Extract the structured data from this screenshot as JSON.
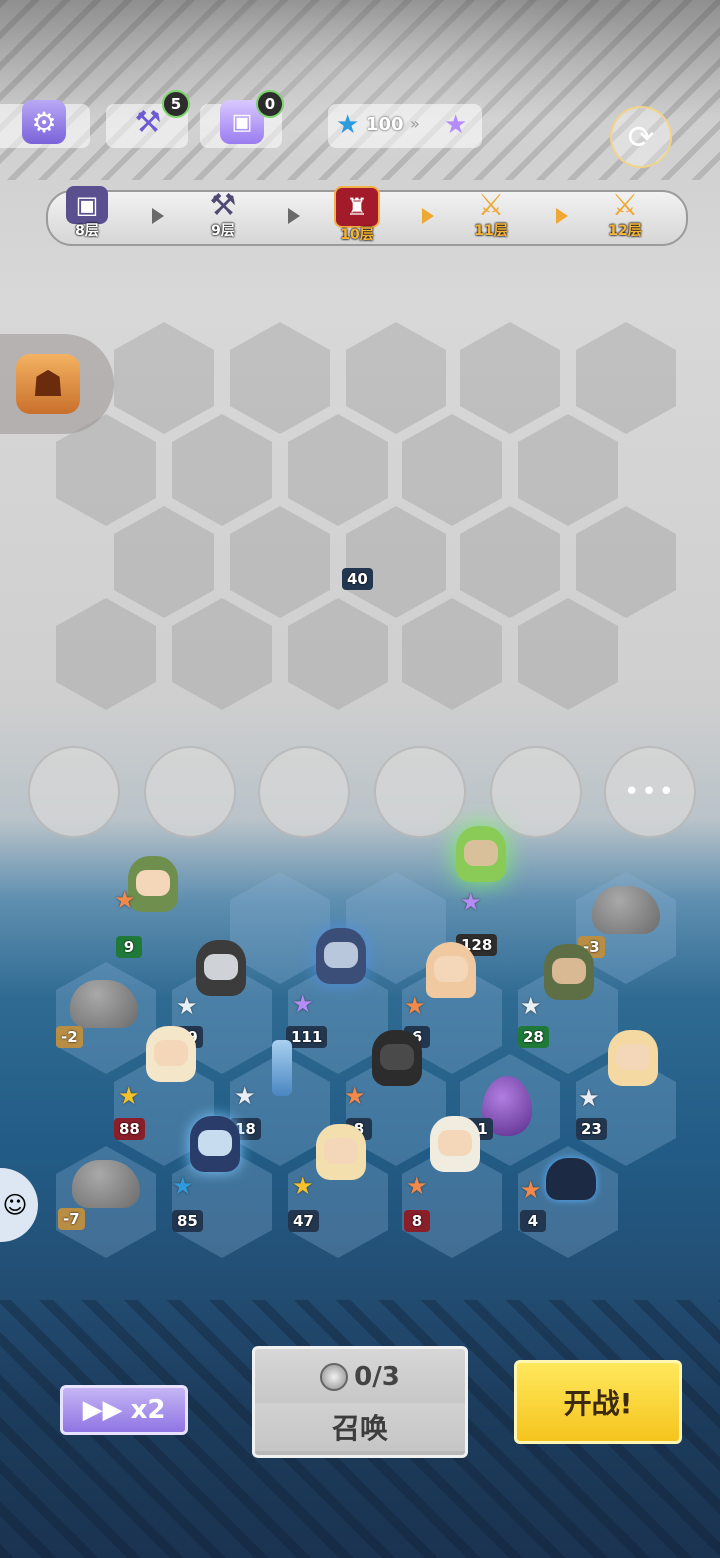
{
  "top_bar": {
    "settings_icon": "gear-icon",
    "anvil_count": "5",
    "chest_count": "0",
    "stars_value": "100",
    "refresh_icon": "refresh-icon"
  },
  "floors": [
    {
      "label": "8层",
      "icon": "chest-icon"
    },
    {
      "label": "9层",
      "icon": "anvil-icon"
    },
    {
      "label": "10层",
      "icon": "helmet-icon"
    },
    {
      "label": "11层",
      "icon": "crossed-swords-icon"
    },
    {
      "label": "12层",
      "icon": "crossed-swords-icon"
    }
  ],
  "board": {
    "enemy_hp": "40"
  },
  "units": [
    {
      "id": "axe-mushroom",
      "value": "9",
      "star": "orange"
    },
    {
      "id": "rock-a",
      "value": "-2"
    },
    {
      "id": "reaper-nun",
      "value": "29",
      "star": "white"
    },
    {
      "id": "dark-nun",
      "value": "111",
      "star": "purple"
    },
    {
      "id": "green-archer",
      "value": "128",
      "star": "purple"
    },
    {
      "id": "mushroom-girl",
      "value": "6",
      "star": "orange"
    },
    {
      "id": "hooded-archer",
      "value": "28",
      "star": "white"
    },
    {
      "id": "rock-b",
      "value": "-3"
    },
    {
      "id": "blonde-priest",
      "value": "88",
      "star": "gold"
    },
    {
      "id": "sword",
      "value": "18",
      "star": "white"
    },
    {
      "id": "hooded-reaper",
      "value": "8",
      "star": "orange"
    },
    {
      "id": "purple-egg",
      "value": "11"
    },
    {
      "id": "blonde-maid",
      "value": "23",
      "star": "white"
    },
    {
      "id": "rock-c",
      "value": "-7"
    },
    {
      "id": "blue-witch",
      "value": "85",
      "star": "blue"
    },
    {
      "id": "maid-broom",
      "value": "47",
      "star": "gold"
    },
    {
      "id": "mushroom-priest",
      "value": "8",
      "star": "orange"
    },
    {
      "id": "blue-slime",
      "value": "4",
      "star": "orange"
    }
  ],
  "controls": {
    "speed_label": "x2",
    "summon_cost": "0/3",
    "summon_label": "召唤",
    "fight_label": "开战!"
  }
}
